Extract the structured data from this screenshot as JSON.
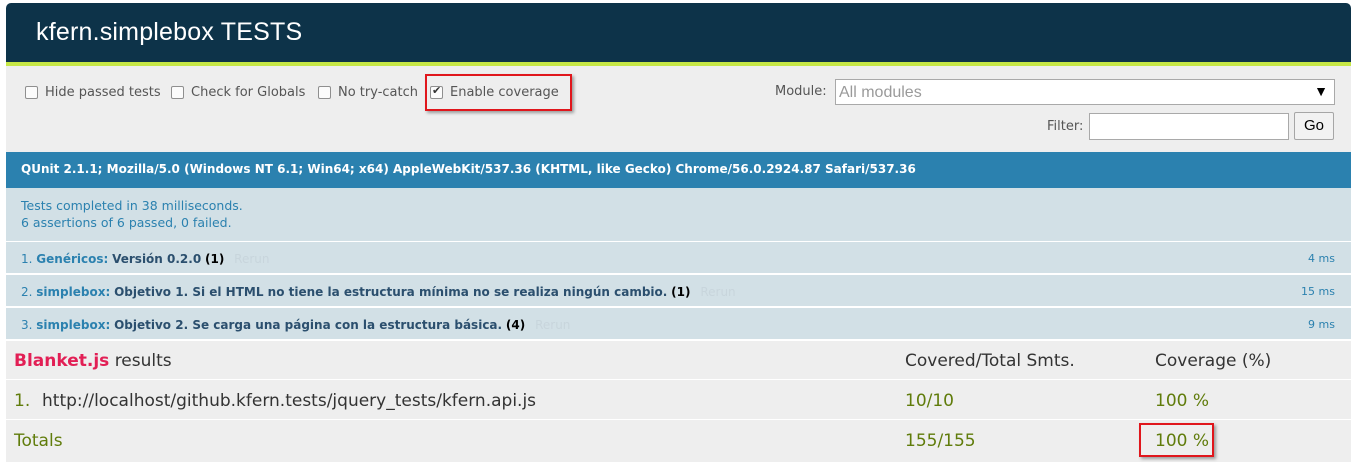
{
  "header": {
    "title": "kfern.simplebox TESTS"
  },
  "toolbar": {
    "options": [
      {
        "label": "Hide passed tests",
        "checked": false
      },
      {
        "label": "Check for Globals",
        "checked": false
      },
      {
        "label": "No try-catch",
        "checked": false
      },
      {
        "label": "Enable coverage",
        "checked": true
      }
    ],
    "module_label": "Module:",
    "module_value": "All modules",
    "filter_label": "Filter:",
    "filter_value": "",
    "go_label": "Go"
  },
  "user_agent": "QUnit 2.1.1; Mozilla/5.0 (Windows NT 6.1; Win64; x64) AppleWebKit/537.36 (KHTML, like Gecko) Chrome/56.0.2924.87 Safari/537.36",
  "summary": {
    "line1": "Tests completed in 38 milliseconds.",
    "line2": "6 assertions of 6 passed, 0 failed."
  },
  "tests": [
    {
      "num": "1.",
      "module": "Genéricos:",
      "name": "Versión 0.2.0",
      "counts": "(1)",
      "rerun": "Rerun",
      "time": "4 ms"
    },
    {
      "num": "2.",
      "module": "simplebox:",
      "name": "Objetivo 1. Si el HTML no tiene la estructura mínima no se realiza ningún cambio.",
      "counts": "(1)",
      "rerun": "Rerun",
      "time": "15 ms"
    },
    {
      "num": "3.",
      "module": "simplebox:",
      "name": "Objetivo 2. Se carga una página con la estructura básica.",
      "counts": "(4)",
      "rerun": "Rerun",
      "time": "9 ms"
    }
  ],
  "blanket": {
    "brand": "Blanket.js",
    "results_label": "results",
    "col_covered": "Covered/Total Smts.",
    "col_coverage": "Coverage (%)",
    "files": [
      {
        "num": "1.",
        "path": "http://localhost/github.kfern.tests/jquery_tests/kfern.api.js",
        "covered": "10/10",
        "coverage": "100 %"
      }
    ],
    "totals": {
      "label": "Totals",
      "covered": "155/155",
      "coverage": "100 %"
    }
  },
  "colors": {
    "header_bg": "#0d3349",
    "accent_stripe": "#c6e746",
    "ua_bg": "#2b81af",
    "pass_bg": "#d2e0e6",
    "blanket_brand": "#e21f55",
    "coverage_green": "#607c0b",
    "highlight": "#e0161c"
  }
}
